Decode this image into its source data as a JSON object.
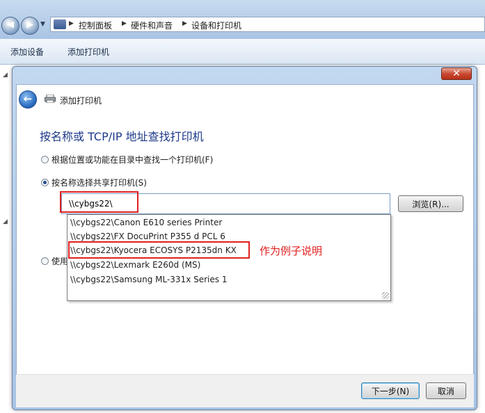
{
  "explorer": {
    "breadcrumbs": [
      "控制面板",
      "硬件和声音",
      "设备和打印机"
    ],
    "commands": [
      "添加设备",
      "添加打印机"
    ]
  },
  "dialog": {
    "title": "添加打印机",
    "close_label": "✕",
    "heading": "按名称或 TCP/IP 地址查找打印机",
    "options": [
      {
        "label": "根据位置或功能在目录中查找一个打印机(F)",
        "checked": false
      },
      {
        "label": "按名称选择共享打印机(S)",
        "checked": true
      },
      {
        "label": "使用",
        "checked": false
      }
    ],
    "printer_input_value": "\\\\cybgs22\\",
    "browse_label": "浏览(R)...",
    "suggestions": [
      "\\\\cybgs22\\Canon E610 series Printer",
      "\\\\cybgs22\\FX DocuPrint P355 d PCL 6",
      "\\\\cybgs22\\Kyocera ECOSYS P2135dn KX",
      "\\\\cybgs22\\Lexmark E260d (MS)",
      "\\\\cybgs22\\Samsung ML-331x Series 1"
    ],
    "next_label": "下一步(N)",
    "cancel_label": "取消"
  },
  "annotation": {
    "text": "作为例子说明",
    "color": "#e02020"
  }
}
